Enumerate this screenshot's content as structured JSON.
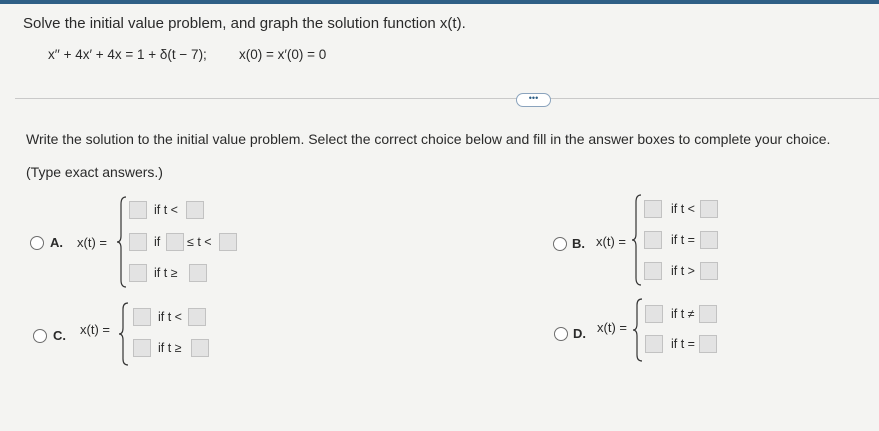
{
  "question": {
    "prompt": "Solve the initial value problem, and graph the solution function x(t).",
    "equation": "x′′ + 4x′ + 4x = 1 + δ(t − 7);",
    "initial_conditions": "x(0) = x′(0) = 0",
    "more_button": "•••",
    "instruction": "Write the solution to the initial value problem. Select the correct choice below and fill in the answer boxes to complete your choice.",
    "hint": "(Type exact answers.)"
  },
  "choices": {
    "a": {
      "letter": "A.",
      "lhs": "x(t) =",
      "row1_cond": "if t <",
      "row2_pre": "if",
      "row2_mid": "≤ t <",
      "row3_cond": "if t ≥"
    },
    "b": {
      "letter": "B.",
      "lhs": "x(t) =",
      "row1_cond": "if t <",
      "row2_cond": "if t =",
      "row3_cond": "if t >"
    },
    "c": {
      "letter": "C.",
      "lhs": "x(t) =",
      "row1_cond": "if t <",
      "row2_cond": "if t ≥"
    },
    "d": {
      "letter": "D.",
      "lhs": "x(t) =",
      "row1_cond": "if t ≠",
      "row2_cond": "if t ="
    }
  }
}
